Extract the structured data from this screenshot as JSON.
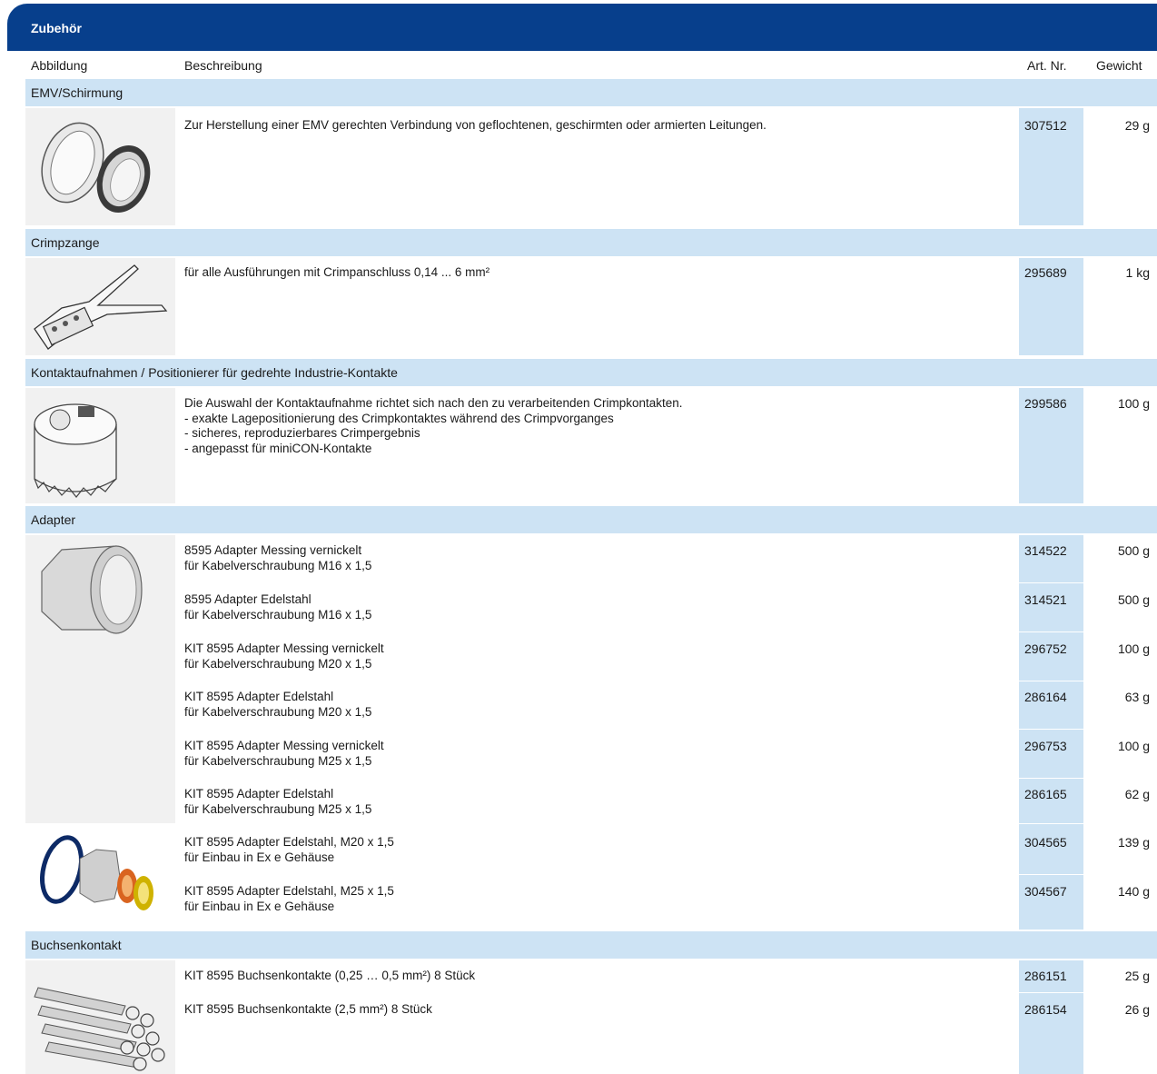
{
  "header": {
    "title": "Zubehör"
  },
  "columns": {
    "image": "Abbildung",
    "description": "Beschreibung",
    "article": "Art. Nr.",
    "weight": "Gewicht"
  },
  "sections": [
    {
      "title": "EMV/Schirmung",
      "image_icon": "emv-ring-icon",
      "rows": [
        {
          "desc": "Zur Herstellung einer EMV gerechten Verbindung von geflochtenen, geschirmten oder armierten Leitungen.",
          "art": "307512",
          "weight": "29 g"
        }
      ]
    },
    {
      "title": "Crimpzange",
      "image_icon": "crimp-pliers-icon",
      "rows": [
        {
          "desc": "für alle Ausführungen mit Crimpanschluss 0,14 ... 6 mm²",
          "art": "295689",
          "weight": "1 kg"
        }
      ]
    },
    {
      "title": "Kontaktaufnahmen / Positionierer für gedrehte Industrie-Kontakte",
      "image_icon": "contact-positioner-icon",
      "rows": [
        {
          "desc": "Die Auswahl der Kontaktaufnahme richtet sich nach den zu verarbeitenden Crimpkontakten.\n- exakte Lagepositionierung des Crimpkontaktes während des Crimpvorganges\n- sicheres, reproduzierbares Crimpergebnis\n- angepasst für miniCON-Kontakte",
          "art": "299586",
          "weight": "100 g"
        }
      ]
    },
    {
      "title": "Adapter",
      "image_icon": "adapter-icon",
      "rows": [
        {
          "desc": "8595 Adapter Messing vernickelt\nfür Kabelverschraubung M16 x 1,5",
          "art": "314522",
          "weight": "500 g"
        },
        {
          "desc": "8595 Adapter Edelstahl\nfür Kabelverschraubung M16 x 1,5",
          "art": "314521",
          "weight": "500 g"
        },
        {
          "desc": "KIT 8595 Adapter Messing vernickelt\nfür Kabelverschraubung M20 x 1,5",
          "art": "296752",
          "weight": "100 g"
        },
        {
          "desc": "KIT 8595 Adapter Edelstahl\nfür Kabelverschraubung M20 x 1,5",
          "art": "286164",
          "weight": "63 g"
        },
        {
          "desc": "KIT 8595 Adapter Messing vernickelt\nfür Kabelverschraubung M25 x 1,5",
          "art": "296753",
          "weight": "100 g"
        },
        {
          "desc": "KIT 8595 Adapter Edelstahl\nfür Kabelverschraubung M25 x 1,5",
          "art": "286165",
          "weight": "62 g"
        },
        {
          "desc": "KIT 8595 Adapter Edelstahl, M20 x 1,5\nfür Einbau in Ex e Gehäuse",
          "art": "304565",
          "weight": "139 g"
        },
        {
          "desc": "KIT 8595 Adapter Edelstahl, M25 x 1,5\nfür Einbau in Ex e Gehäuse",
          "art": "304567",
          "weight": "140 g"
        }
      ]
    },
    {
      "title": "Buchsenkontakt",
      "image_icon": "socket-contacts-icon",
      "rows": [
        {
          "desc": "KIT 8595 Buchsenkontakte (0,25 … 0,5 mm²) 8 Stück",
          "art": "286151",
          "weight": "25 g"
        },
        {
          "desc": "KIT 8595 Buchsenkontakte (2,5 mm²) 8 Stück",
          "art": "286154",
          "weight": "26 g"
        }
      ]
    }
  ],
  "colors": {
    "header_blue": "#073f8c",
    "row_blue": "#cde3f4",
    "image_bg": "#f1f1f1"
  }
}
